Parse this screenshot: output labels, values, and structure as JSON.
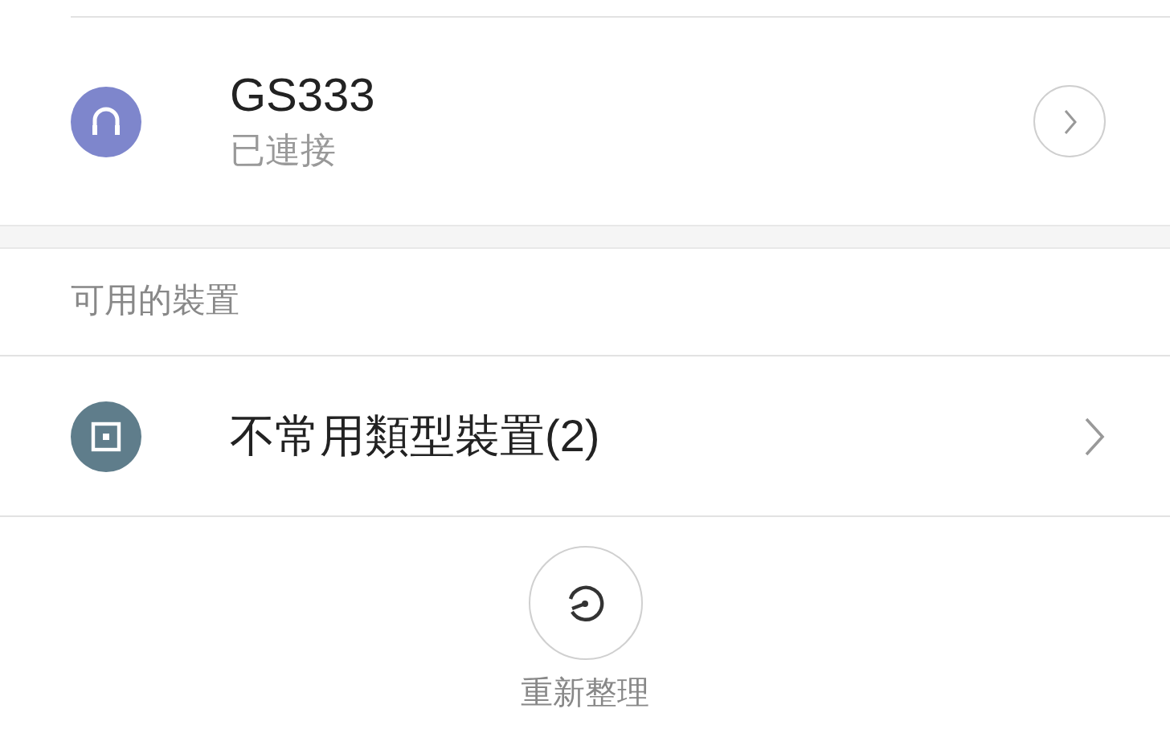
{
  "paired_devices": [
    {
      "kind": "headphones",
      "name": "GS333",
      "status": "已連接",
      "color": "#7e86cc"
    }
  ],
  "available": {
    "header": "可用的裝置",
    "items": [
      {
        "kind": "other",
        "name": "不常用類型裝置(2)",
        "color": "#5f7d8b"
      }
    ]
  },
  "refresh": {
    "label": "重新整理"
  }
}
